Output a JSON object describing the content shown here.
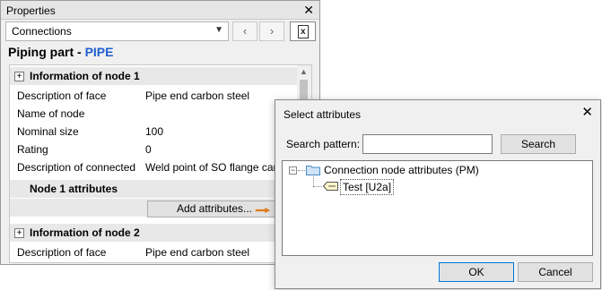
{
  "properties": {
    "title": "Properties",
    "close_glyph": "✕",
    "combo_value": "Connections",
    "heading_prefix": "Piping part -",
    "heading_type": "PIPE",
    "sections": [
      {
        "label": "Information of node 1",
        "expander": "+"
      },
      {
        "label": "Information of node 2",
        "expander": "+"
      }
    ],
    "rows": [
      {
        "label": "Description of face",
        "value": "Pipe end carbon steel"
      },
      {
        "label": "Name of node",
        "value": ""
      },
      {
        "label": "Nominal size",
        "value": "100"
      },
      {
        "label": "Rating",
        "value": "0"
      },
      {
        "label": "Description of connected",
        "value": "Weld point of SO flange carbon steel"
      }
    ],
    "node1_attributes_label": "Node 1 attributes",
    "add_attributes_label": "Add attributes...",
    "node2_rows": [
      {
        "label": "Description of face",
        "value": "Pipe end carbon steel"
      }
    ],
    "icons": {
      "combo_arrow": "chevron-down-icon",
      "prev": "chevron-left-icon",
      "next": "chevron-right-icon",
      "excel": "excel-export-icon"
    },
    "arrow_color": "#e07b1a"
  },
  "dialog": {
    "title": "Select attributes",
    "close_glyph": "✕",
    "search_label": "Search pattern:",
    "search_value": "",
    "search_button": "Search",
    "tree": {
      "root_toggle": "−",
      "root_label": "Connection node attributes (PM)",
      "child_label": "Test [U2a]"
    },
    "ok_label": "OK",
    "cancel_label": "Cancel"
  }
}
